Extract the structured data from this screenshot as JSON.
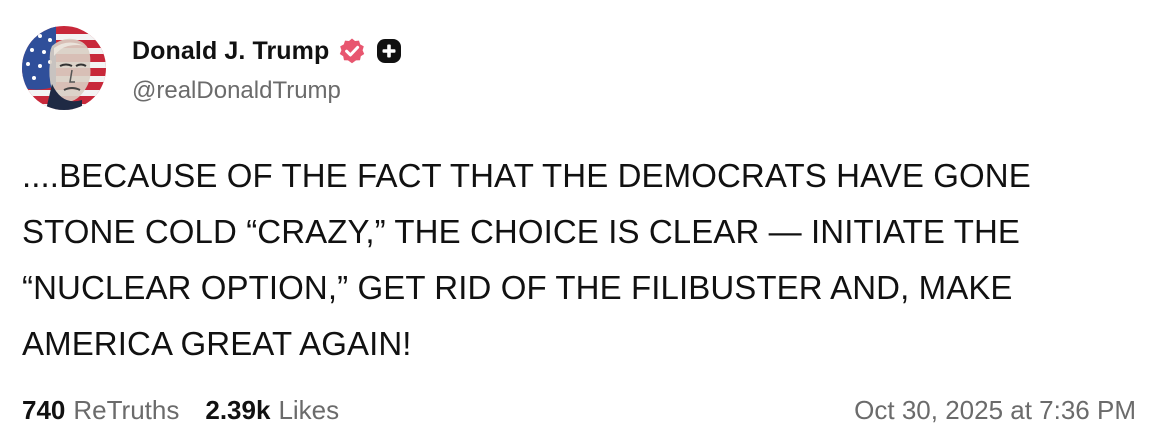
{
  "author": {
    "display_name": "Donald J. Trump",
    "handle": "@realDonaldTrump",
    "verified_icon": "verified-check-badge-icon",
    "plus_icon": "plus-badge-icon",
    "verified_color": "#e8566f",
    "badge_color": "#111111"
  },
  "post": {
    "text": "....BECAUSE OF THE FACT THAT THE DEMOCRATS HAVE GONE\nSTONE COLD “CRAZY,” THE CHOICE IS CLEAR — INITIATE THE\n“NUCLEAR OPTION,” GET RID OF THE FILIBUSTER AND, MAKE\nAMERICA GREAT AGAIN!"
  },
  "stats": {
    "retruths_count": "740",
    "retruths_label": "ReTruths",
    "likes_count": "2.39k",
    "likes_label": "Likes"
  },
  "timestamp": "Oct 30, 2025 at 7:36 PM"
}
